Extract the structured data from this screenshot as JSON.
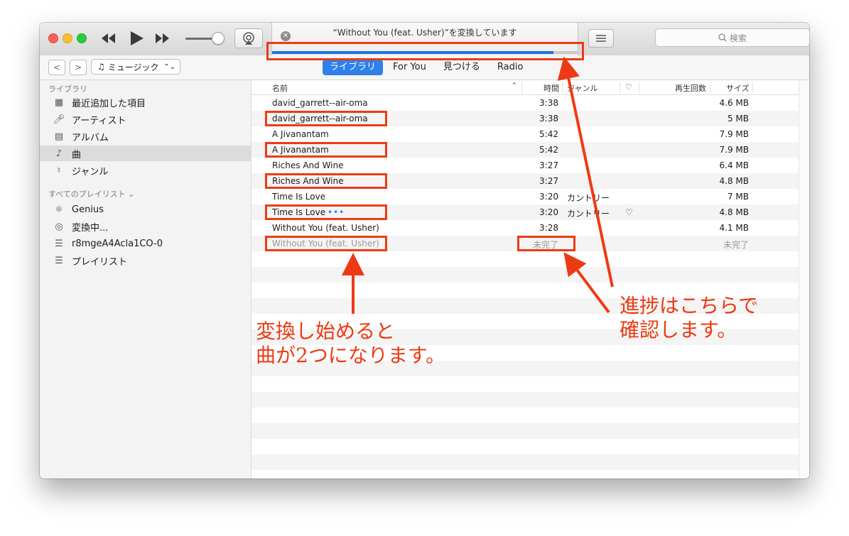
{
  "window": {
    "lcd_title": "“Without You (feat. Usher)”を変換しています",
    "lcd_progress": 0.92,
    "search_placeholder": "検索",
    "media_kind": "ミュージック"
  },
  "tabs": [
    {
      "label": "ライブラリ",
      "active": true
    },
    {
      "label": "For You",
      "active": false
    },
    {
      "label": "見つける",
      "active": false
    },
    {
      "label": "Radio",
      "active": false
    }
  ],
  "sidebar": {
    "library_header": "ライブラリ",
    "library_items": [
      {
        "label": "最近追加した項目",
        "icon": "grid-icon"
      },
      {
        "label": "アーティスト",
        "icon": "microphone-icon"
      },
      {
        "label": "アルバム",
        "icon": "album-icon"
      },
      {
        "label": "曲",
        "icon": "music-note-icon",
        "active": true
      },
      {
        "label": "ジャンル",
        "icon": "genre-icon"
      }
    ],
    "playlists_header": "すべてのプレイリスト ⌄",
    "playlist_items": [
      {
        "label": "Genius",
        "icon": "atom-icon"
      },
      {
        "label": "変換中...",
        "icon": "waveform-icon"
      },
      {
        "label": "r8mgeA4Acla1CO-0",
        "icon": "playlist-icon"
      },
      {
        "label": "プレイリスト",
        "icon": "playlist-icon"
      }
    ]
  },
  "table": {
    "columns": {
      "name": "名前",
      "time": "時間",
      "genre": "ジャンル",
      "heart": "♡",
      "plays": "再生回数",
      "size": "サイズ"
    },
    "rows": [
      {
        "name": "david_garrett--air-oma",
        "time": "3:38",
        "genre": "",
        "heart": "",
        "size": "4.6 MB"
      },
      {
        "name": "david_garrett--air-oma",
        "time": "3:38",
        "genre": "",
        "heart": "",
        "size": "5 MB"
      },
      {
        "name": "A Jivanantam",
        "time": "5:42",
        "genre": "",
        "heart": "",
        "size": "7.9 MB"
      },
      {
        "name": "A Jivanantam",
        "time": "5:42",
        "genre": "",
        "heart": "",
        "size": "7.9 MB"
      },
      {
        "name": "Riches And Wine",
        "time": "3:27",
        "genre": "",
        "heart": "",
        "size": "6.4 MB"
      },
      {
        "name": "Riches And Wine",
        "time": "3:27",
        "genre": "",
        "heart": "",
        "size": "4.8 MB"
      },
      {
        "name": "Time Is Love",
        "time": "3:20",
        "genre": "カントリー",
        "heart": "",
        "size": "7 MB"
      },
      {
        "name": "Time Is Love",
        "time": "3:20",
        "genre": "カントリー",
        "heart": "♡",
        "size": "4.8 MB",
        "dots": "•••"
      },
      {
        "name": "Without You (feat. Usher)",
        "time": "3:28",
        "genre": "",
        "heart": "",
        "size": "4.1 MB"
      },
      {
        "name": "Without You (feat. Usher)",
        "time": "未完了",
        "genre": "",
        "heart": "",
        "size": "未完了",
        "grey": true
      }
    ]
  },
  "annotations": {
    "left_line1": "変換し始めると",
    "left_line2": "曲が2つになります。",
    "right_line1": "進捗はこちらで",
    "right_line2": "確認します。",
    "color": "#ee3a14"
  }
}
